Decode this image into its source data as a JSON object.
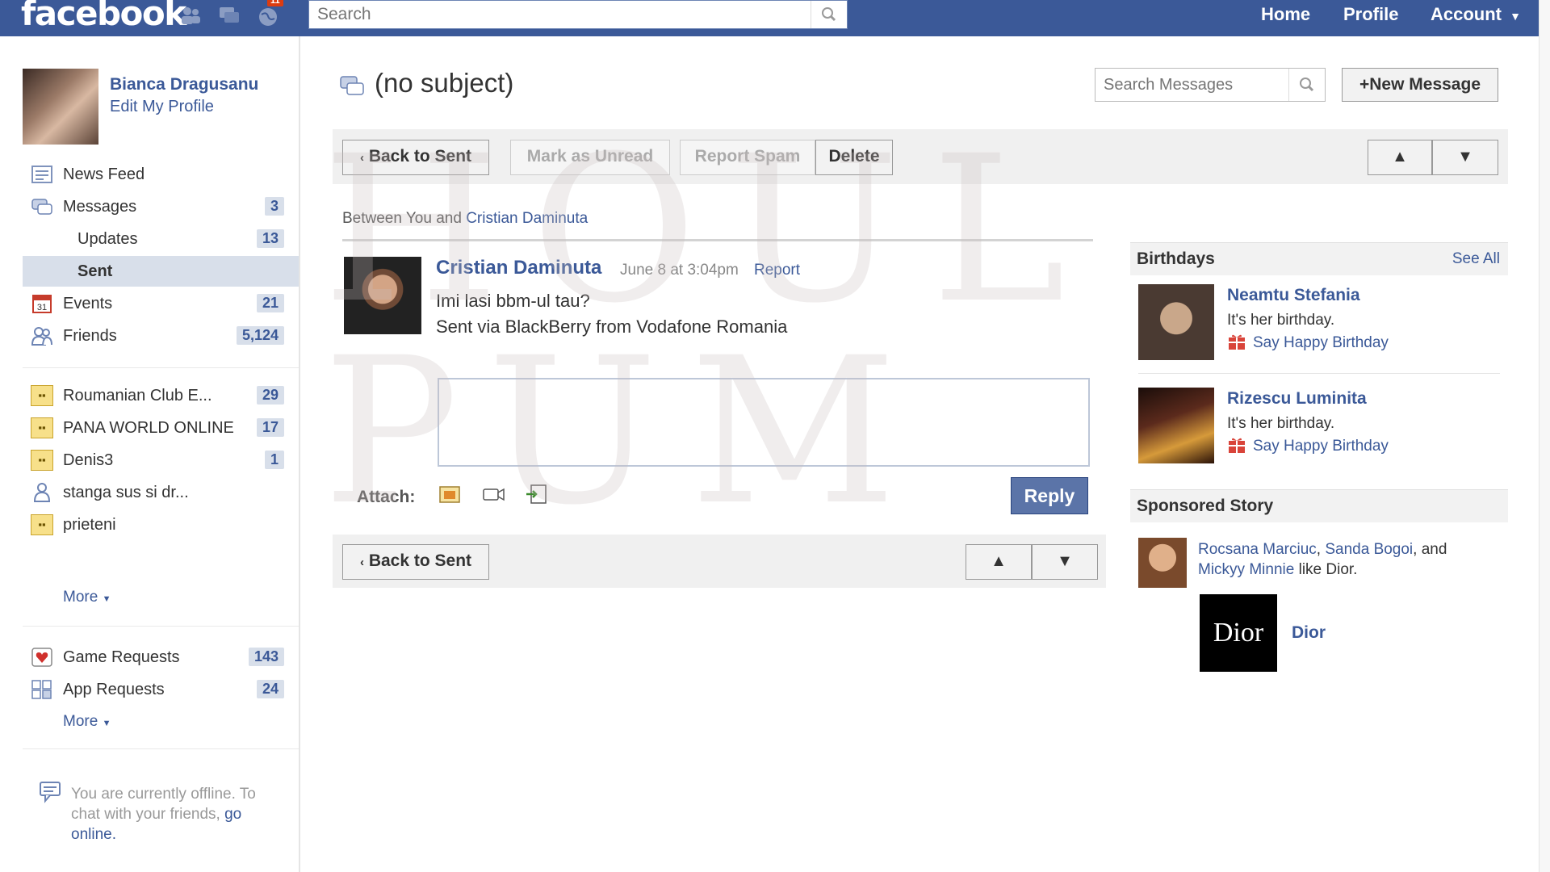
{
  "topbar": {
    "logo": "facebook",
    "notif_badge": "11",
    "search_placeholder": "Search",
    "nav": {
      "home": "Home",
      "profile": "Profile",
      "account": "Account"
    }
  },
  "profile": {
    "name": "Bianca Dragusanu",
    "edit_link": "Edit My Profile"
  },
  "sidebar": {
    "items": [
      {
        "label": "News Feed",
        "count": ""
      },
      {
        "label": "Messages",
        "count": "3"
      },
      {
        "label": "Updates",
        "count": "13"
      },
      {
        "label": "Sent",
        "count": ""
      },
      {
        "label": "Events",
        "count": "21"
      },
      {
        "label": "Friends",
        "count": "5,124"
      }
    ],
    "groups": [
      {
        "label": "Roumanian Club E...",
        "count": "29"
      },
      {
        "label": "PANA WORLD ONLINE",
        "count": "17"
      },
      {
        "label": "Denis3",
        "count": "1"
      },
      {
        "label": "stanga sus si dr...",
        "count": ""
      },
      {
        "label": "prieteni",
        "count": ""
      }
    ],
    "more_label": "More",
    "requests": [
      {
        "label": "Game Requests",
        "count": "143"
      },
      {
        "label": "App Requests",
        "count": "24"
      }
    ],
    "more_label_2": "More",
    "offline_text": "You are currently offline. To chat with your friends, ",
    "offline_link": "go online."
  },
  "message": {
    "subject": "(no subject)",
    "search_placeholder": "Search Messages",
    "new_message": "New Message",
    "back_to_sent": "Back to Sent",
    "mark_unread": "Mark as Unread",
    "report_spam": "Report Spam",
    "delete": "Delete",
    "between_prefix": "Between You and ",
    "between_name": "Cristian Daminuta",
    "sender": "Cristian Daminuta",
    "time": "June 8 at 3:04pm",
    "report": "Report",
    "body_line1": "Imi lasi bbm-ul tau?",
    "body_line2": "Sent via BlackBerry from Vodafone Romania",
    "attach_label": "Attach:",
    "reply": "Reply",
    "up_arrow": "▲",
    "down_arrow": "▼"
  },
  "birthdays": {
    "title": "Birthdays",
    "see_all": "See All",
    "people": [
      {
        "name": "Neamtu Stefania",
        "text": "It's her birthday.",
        "link": "Say Happy Birthday"
      },
      {
        "name": "Rizescu Luminita",
        "text": "It's her birthday.",
        "link": "Say Happy Birthday"
      }
    ]
  },
  "sponsored": {
    "title": "Sponsored Story",
    "name1": "Rocsana Marciuc",
    "name2": "Sanda Bogoi",
    "and_text": ", and",
    "name3": "Mickyy Minnie",
    "like_text": " like Dior.",
    "brand_logo": "Dior",
    "brand_name": "Dior"
  },
  "watermark": "HOUL PUM",
  "colors": {
    "brand": "#3b5998",
    "badge": "#d8dfea",
    "button_blue": "#5b74a8"
  }
}
